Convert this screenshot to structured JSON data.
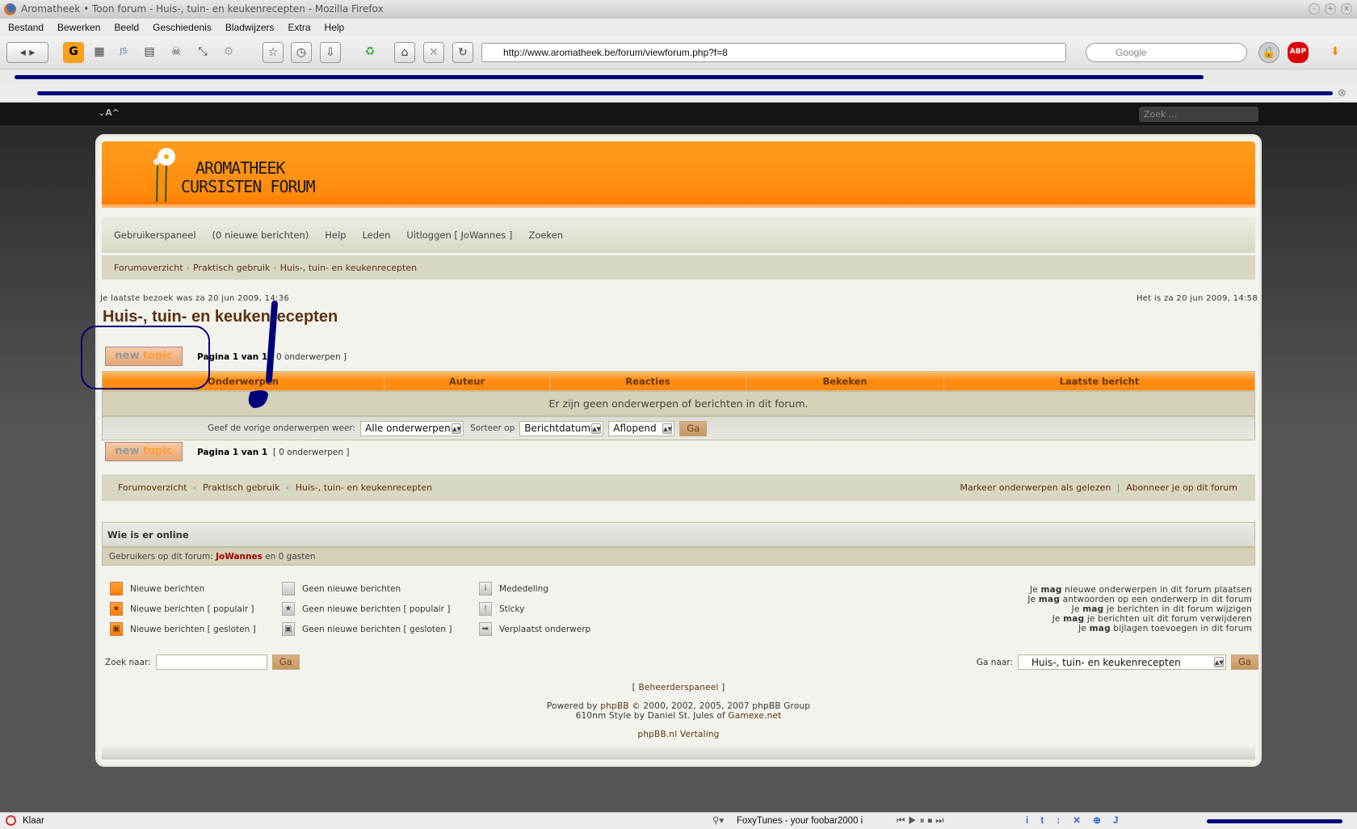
{
  "window": {
    "title": "Aromatheek • Toon forum - Huis-, tuin- en keukenrecepten - Mozilla Firefox"
  },
  "menu": [
    "Bestand",
    "Bewerken",
    "Beeld",
    "Geschiedenis",
    "Bladwijzers",
    "Extra",
    "Help"
  ],
  "toolbar": {
    "url": "http://www.aromatheek.be/forum/viewforum.php?f=8",
    "search_placeholder": "Google"
  },
  "page_top": {
    "font_size_control": "⌄A^",
    "search_placeholder": "Zoek ..."
  },
  "header": {
    "logo_line1": "AROMATHEEK",
    "logo_line2": "CURSISTEN FORUM"
  },
  "nav": {
    "ucp": "Gebruikerspaneel",
    "new_messages": "(0 nieuwe berichten)",
    "help": "Help",
    "members": "Leden",
    "logout": "Uitloggen [ JoWannes ]",
    "search": "Zoeken"
  },
  "breadcrumb": {
    "items": [
      "Forumoverzicht",
      "Praktisch gebruik",
      "Huis-, tuin- en keukenrecepten"
    ],
    "sep": "‹"
  },
  "info": {
    "last_visit": "Je laatste bezoek was za 20 jun 2009, 14:36",
    "current_time": "Het is za 20 jun 2009, 14:58"
  },
  "forum": {
    "title": "Huis-, tuin- en keukenrecepten",
    "new_topic_word1": "new",
    "new_topic_word2": "topic",
    "pagination": "Pagina 1 van 1",
    "topic_count": "[ 0 onderwerpen ]",
    "columns": [
      "Onderwerpen",
      "Auteur",
      "Reacties",
      "Bekeken",
      "Laatste bericht"
    ],
    "empty_message": "Er zijn geen onderwerpen of berichten in dit forum.",
    "sort": {
      "show_label": "Geef de vorige onderwerpen weer:",
      "show_value": "Alle onderwerpen",
      "sort_label": "Sorteer op",
      "sort_value": "Berichtdatum",
      "order_value": "Aflopend",
      "go": "Ga"
    }
  },
  "actions": {
    "mark_read": "Markeer onderwerpen als gelezen",
    "subscribe": "Abonneer je op dit forum",
    "sep": "|"
  },
  "online": {
    "heading": "Wie is er online",
    "users_prefix": "Gebruikers op dit forum:",
    "user": "JoWannes",
    "users_suffix": "en 0 gasten"
  },
  "legend": [
    {
      "label": "Nieuwe berichten",
      "icon": "new-posts-icon"
    },
    {
      "label": "Nieuwe berichten [ populair ]",
      "icon": "new-posts-hot-icon"
    },
    {
      "label": "Nieuwe berichten [ gesloten ]",
      "icon": "new-posts-locked-icon"
    },
    {
      "label": "Geen nieuwe berichten",
      "icon": "no-new-posts-icon"
    },
    {
      "label": "Geen nieuwe berichten [ populair ]",
      "icon": "no-new-posts-hot-icon"
    },
    {
      "label": "Geen nieuwe berichten [ gesloten ]",
      "icon": "no-new-posts-locked-icon"
    },
    {
      "label": "Mededeling",
      "icon": "announcement-icon"
    },
    {
      "label": "Sticky",
      "icon": "sticky-icon"
    },
    {
      "label": "Verplaatst onderwerp",
      "icon": "moved-topic-icon"
    }
  ],
  "permissions": {
    "prefix": "Je",
    "may": "mag",
    "items": [
      "nieuwe onderwerpen in dit forum plaatsen",
      "antwoorden op een onderwerp in dit forum",
      "je berichten in dit forum wijzigen",
      "je berichten uit dit forum verwijderen",
      "bijlagen toevoegen in dit forum"
    ]
  },
  "search": {
    "label": "Zoek naar:",
    "value": "",
    "go": "Ga"
  },
  "jump": {
    "label": "Ga naar:",
    "value": "Huis-, tuin- en keukenrecepten",
    "go": "Ga"
  },
  "footer": {
    "admin_open": "[",
    "admin": "Beheerderspaneel",
    "admin_close": "]",
    "powered_prefix": "Powered by",
    "phpbb": "phpBB",
    "powered_suffix": "© 2000, 2002, 2005, 2007 phpBB Group",
    "style_prefix": "610nm Style by Daniel St. Jules of",
    "style_link": "Gamexe.net",
    "translation": "phpBB.nl Vertaling"
  },
  "statusbar": {
    "status": "Klaar",
    "foxytunes": "FoxyTunes - your foobar2000 i"
  }
}
